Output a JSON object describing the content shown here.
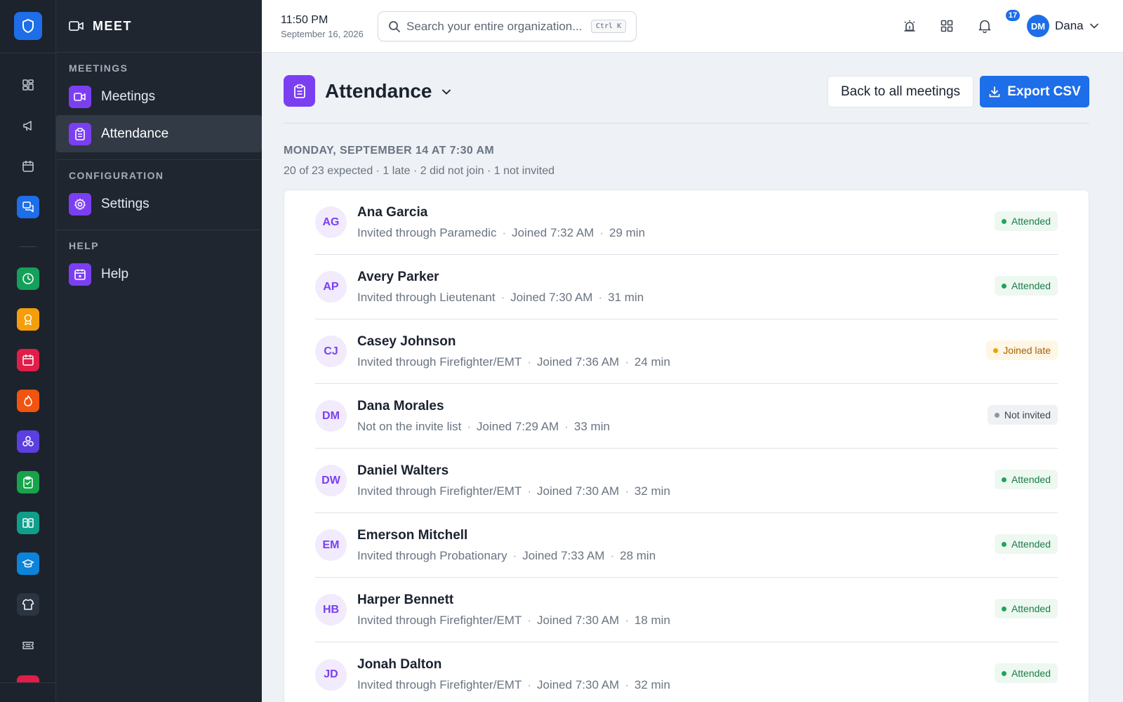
{
  "app": {
    "module_title": "MEET"
  },
  "rail": {
    "items": [
      {
        "icon": "dashboard-icon",
        "color": "transparent"
      },
      {
        "icon": "megaphone-icon",
        "color": "transparent"
      },
      {
        "icon": "calendar-icon",
        "color": "transparent"
      },
      {
        "icon": "chat-icon",
        "color": "#1d6ee8"
      },
      {
        "icon": "clock-icon",
        "color": "#14a05a"
      },
      {
        "icon": "award-icon",
        "color": "#f59e0b"
      },
      {
        "icon": "calendar-red-icon",
        "color": "#e11d48"
      },
      {
        "icon": "flame-icon",
        "color": "#f0540f"
      },
      {
        "icon": "network-icon",
        "color": "#5b3fe0"
      },
      {
        "icon": "clipboard-check-icon",
        "color": "#16a34a"
      },
      {
        "icon": "book-icon",
        "color": "#0f9e8a"
      },
      {
        "icon": "graduation-cap-icon",
        "color": "#0b84d9"
      },
      {
        "icon": "shirt-icon",
        "color": "#2b3441"
      },
      {
        "icon": "ticket-icon",
        "color": "transparent"
      }
    ]
  },
  "sidebar": {
    "sections": [
      {
        "label": "MEETINGS",
        "items": [
          {
            "label": "Meetings",
            "icon": "video-icon",
            "active": false
          },
          {
            "label": "Attendance",
            "icon": "clipboard-icon",
            "active": true
          }
        ]
      },
      {
        "label": "CONFIGURATION",
        "items": [
          {
            "label": "Settings",
            "icon": "gear-icon",
            "active": false
          }
        ]
      },
      {
        "label": "HELP",
        "items": [
          {
            "label": "Help",
            "icon": "calendar-icon",
            "active": false
          }
        ]
      }
    ]
  },
  "topbar": {
    "time": "11:50 PM",
    "date": "September 16, 2026",
    "search_placeholder": "Search your entire organization...",
    "shortcut": "Ctrl K",
    "notifications_count": "17",
    "user_initials": "DM",
    "user_name": "Dana"
  },
  "page": {
    "title": "Attendance",
    "back_label": "Back to all meetings",
    "export_label": "Export CSV",
    "meeting_title": "MONDAY, SEPTEMBER 14 AT 7:30 AM",
    "summary": "20 of 23 expected · 1 late · 2 did not join · 1 not invited"
  },
  "attendees": [
    {
      "initials": "AG",
      "name": "Ana Garcia",
      "via": "Invited through Paramedic",
      "joined": "Joined 7:32 AM",
      "duration": "29 min",
      "status": "Attended",
      "kind": "attended"
    },
    {
      "initials": "AP",
      "name": "Avery Parker",
      "via": "Invited through Lieutenant",
      "joined": "Joined 7:30 AM",
      "duration": "31 min",
      "status": "Attended",
      "kind": "attended"
    },
    {
      "initials": "CJ",
      "name": "Casey Johnson",
      "via": "Invited through Firefighter/EMT",
      "joined": "Joined 7:36 AM",
      "duration": "24 min",
      "status": "Joined late",
      "kind": "late"
    },
    {
      "initials": "DM",
      "name": "Dana Morales",
      "via": "Not on the invite list",
      "joined": "Joined 7:29 AM",
      "duration": "33 min",
      "status": "Not invited",
      "kind": "noinv"
    },
    {
      "initials": "DW",
      "name": "Daniel Walters",
      "via": "Invited through Firefighter/EMT",
      "joined": "Joined 7:30 AM",
      "duration": "32 min",
      "status": "Attended",
      "kind": "attended"
    },
    {
      "initials": "EM",
      "name": "Emerson Mitchell",
      "via": "Invited through Probationary",
      "joined": "Joined 7:33 AM",
      "duration": "28 min",
      "status": "Attended",
      "kind": "attended"
    },
    {
      "initials": "HB",
      "name": "Harper Bennett",
      "via": "Invited through Firefighter/EMT",
      "joined": "Joined 7:30 AM",
      "duration": "18 min",
      "status": "Attended",
      "kind": "attended"
    },
    {
      "initials": "JD",
      "name": "Jonah Dalton",
      "via": "Invited through Firefighter/EMT",
      "joined": "Joined 7:30 AM",
      "duration": "32 min",
      "status": "Attended",
      "kind": "attended"
    }
  ]
}
